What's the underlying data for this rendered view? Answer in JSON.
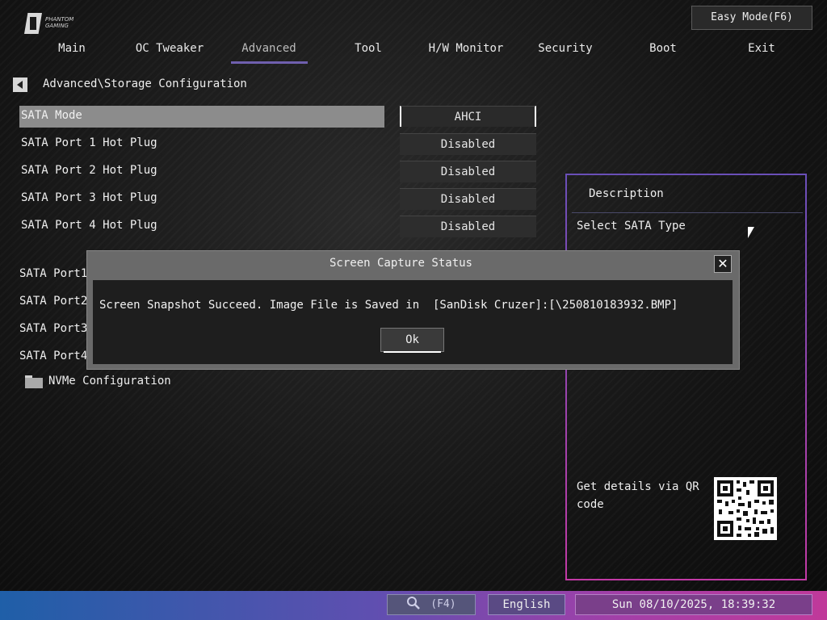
{
  "logo": {
    "line1": "PHANTOM",
    "line2": "GAMING"
  },
  "easy_mode": "Easy Mode(F6)",
  "tabs": [
    {
      "label": "Main"
    },
    {
      "label": "OC Tweaker"
    },
    {
      "label": "Advanced",
      "active": true
    },
    {
      "label": "Tool"
    },
    {
      "label": "H/W Monitor"
    },
    {
      "label": "Security"
    },
    {
      "label": "Boot"
    },
    {
      "label": "Exit"
    }
  ],
  "breadcrumb": "Advanced\\Storage Configuration",
  "settings": [
    {
      "label": "SATA Mode",
      "value": "AHCI"
    },
    {
      "label": "SATA Port 1 Hot Plug",
      "value": "Disabled"
    },
    {
      "label": "SATA Port 2 Hot Plug",
      "value": "Disabled"
    },
    {
      "label": "SATA Port 3 Hot Plug",
      "value": "Disabled"
    },
    {
      "label": "SATA Port 4 Hot Plug",
      "value": "Disabled"
    }
  ],
  "ports": [
    {
      "label": "SATA Port1"
    },
    {
      "label": "SATA Port2"
    },
    {
      "label": "SATA Port3"
    },
    {
      "label": "SATA Port4"
    }
  ],
  "nvme": "NVMe Configuration",
  "description": {
    "title": "Description",
    "text": "Select SATA Type",
    "qr_text": "Get details via QR code"
  },
  "dialog": {
    "title": "Screen Capture Status",
    "message": "Screen Snapshot Succeed. Image File is Saved in  [SanDisk Cruzer]:[\\250810183932.BMP]",
    "ok": "Ok"
  },
  "bottom": {
    "search": "(F4)",
    "language": "English",
    "datetime": "Sun 08/10/2025, 18:39:32"
  }
}
